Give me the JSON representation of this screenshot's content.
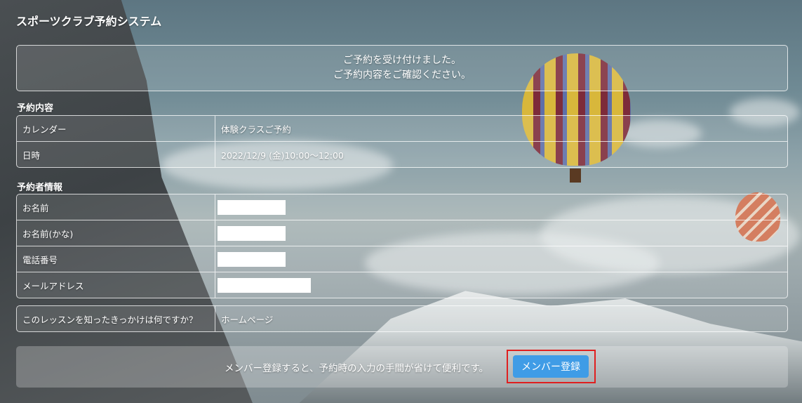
{
  "app": {
    "title": "スポーツクラブ予約システム"
  },
  "notice": {
    "line1": "ご予約を受け付けました。",
    "line2": "ご予約内容をご確認ください。"
  },
  "reservation": {
    "heading": "予約内容",
    "rows": [
      {
        "label": "カレンダー",
        "value": "体験クラスご予約"
      },
      {
        "label": "日時",
        "value": "2022/12/9 (金)10:00～12:00"
      }
    ]
  },
  "reserver": {
    "heading": "予約者情報",
    "rows": [
      {
        "label": "お名前",
        "value": ""
      },
      {
        "label": "お名前(かな)",
        "value": ""
      },
      {
        "label": "電話番号",
        "value": ""
      },
      {
        "label": "メールアドレス",
        "value": ""
      }
    ]
  },
  "survey": {
    "label": "このレッスンを知ったきっかけは何ですか？",
    "value": "ホームページ"
  },
  "footer": {
    "text": "メンバー登録すると、予約時の入力の手間が省けて便利です。",
    "button_label": "メンバー登録"
  },
  "colors": {
    "button": "#3f9ce6",
    "highlight": "#e01f1f"
  }
}
